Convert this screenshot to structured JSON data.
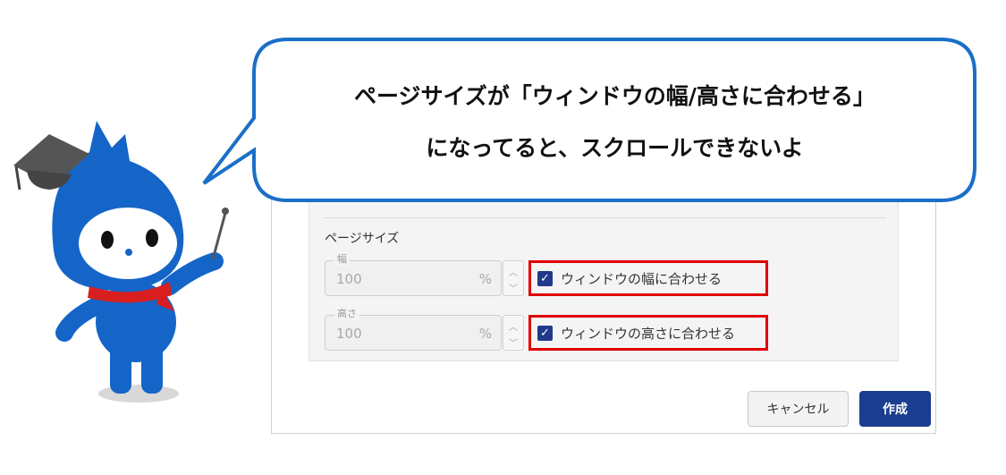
{
  "bubble": {
    "line1": "ページサイズが「ウィンドウの幅/高さに合わせる」",
    "line2": "になってると、スクロールできないよ"
  },
  "dialog": {
    "section_label": "ページサイズ",
    "width_field": {
      "label": "幅",
      "value": "100",
      "unit": "%"
    },
    "height_field": {
      "label": "高さ",
      "value": "100",
      "unit": "%"
    },
    "fit_width": {
      "label": "ウィンドウの幅に合わせる",
      "checked": true
    },
    "fit_height": {
      "label": "ウィンドウの高さに合わせる",
      "checked": true
    },
    "cancel_label": "キャンセル",
    "create_label": "作成"
  },
  "colors": {
    "bubble_border": "#1a6fc8",
    "highlight": "#e00000",
    "checkbox": "#1f3a8a",
    "primary_button": "#1a3d8f",
    "mascot": "#1565c8"
  },
  "icons": {
    "mascot": "mascot-character-icon",
    "cap": "graduation-cap-icon",
    "pointer": "pointer-stick-icon",
    "stepper_up": "chevron-up-icon",
    "stepper_down": "chevron-down-icon",
    "check": "checkmark-icon"
  }
}
